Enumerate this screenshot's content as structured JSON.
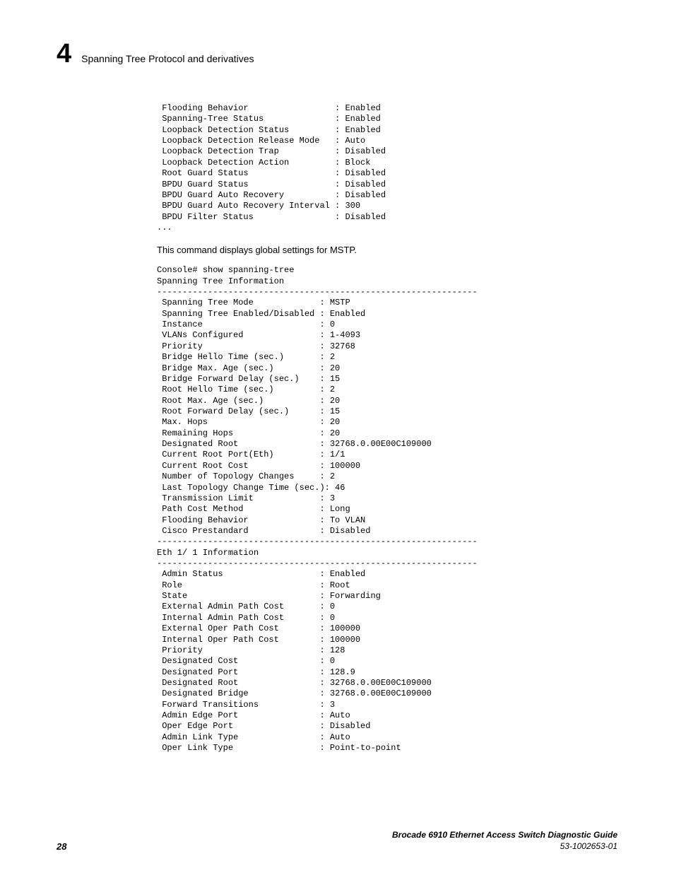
{
  "header": {
    "chapter_number": "4",
    "chapter_title": "Spanning Tree Protocol and derivatives"
  },
  "block1": " Flooding Behavior                 : Enabled\n Spanning-Tree Status              : Enabled\n Loopback Detection Status         : Enabled\n Loopback Detection Release Mode   : Auto\n Loopback Detection Trap           : Disabled\n Loopback Detection Action         : Block\n Root Guard Status                 : Disabled\n BPDU Guard Status                 : Disabled\n BPDU Guard Auto Recovery          : Disabled\n BPDU Guard Auto Recovery Interval : 300\n BPDU Filter Status                : Disabled\n...",
  "caption": "This command displays global settings for MSTP.",
  "block2": "Console# show spanning-tree\nSpanning Tree Information\n---------------------------------------------------------------\n Spanning Tree Mode             : MSTP\n Spanning Tree Enabled/Disabled : Enabled\n Instance                       : 0\n VLANs Configured               : 1-4093\n Priority                       : 32768\n Bridge Hello Time (sec.)       : 2\n Bridge Max. Age (sec.)         : 20\n Bridge Forward Delay (sec.)    : 15\n Root Hello Time (sec.)         : 2\n Root Max. Age (sec.)           : 20\n Root Forward Delay (sec.)      : 15\n Max. Hops                      : 20\n Remaining Hops                 : 20\n Designated Root                : 32768.0.00E00C109000\n Current Root Port(Eth)         : 1/1\n Current Root Cost              : 100000\n Number of Topology Changes     : 2\n Last Topology Change Time (sec.): 46\n Transmission Limit             : 3\n Path Cost Method               : Long\n Flooding Behavior              : To VLAN\n Cisco Prestandard              : Disabled\n---------------------------------------------------------------\nEth 1/ 1 Information\n---------------------------------------------------------------\n Admin Status                   : Enabled\n Role                           : Root\n State                          : Forwarding\n External Admin Path Cost       : 0\n Internal Admin Path Cost       : 0\n External Oper Path Cost        : 100000\n Internal Oper Path Cost        : 100000\n Priority                       : 128\n Designated Cost                : 0\n Designated Port                : 128.9\n Designated Root                : 32768.0.00E00C109000\n Designated Bridge              : 32768.0.00E00C109000\n Forward Transitions            : 3\n Admin Edge Port                : Auto\n Oper Edge Port                 : Disabled\n Admin Link Type                : Auto\n Oper Link Type                 : Point-to-point",
  "footer": {
    "page_number": "28",
    "doc_title": "Brocade 6910 Ethernet Access Switch Diagnostic Guide",
    "doc_number": "53-1002653-01"
  }
}
